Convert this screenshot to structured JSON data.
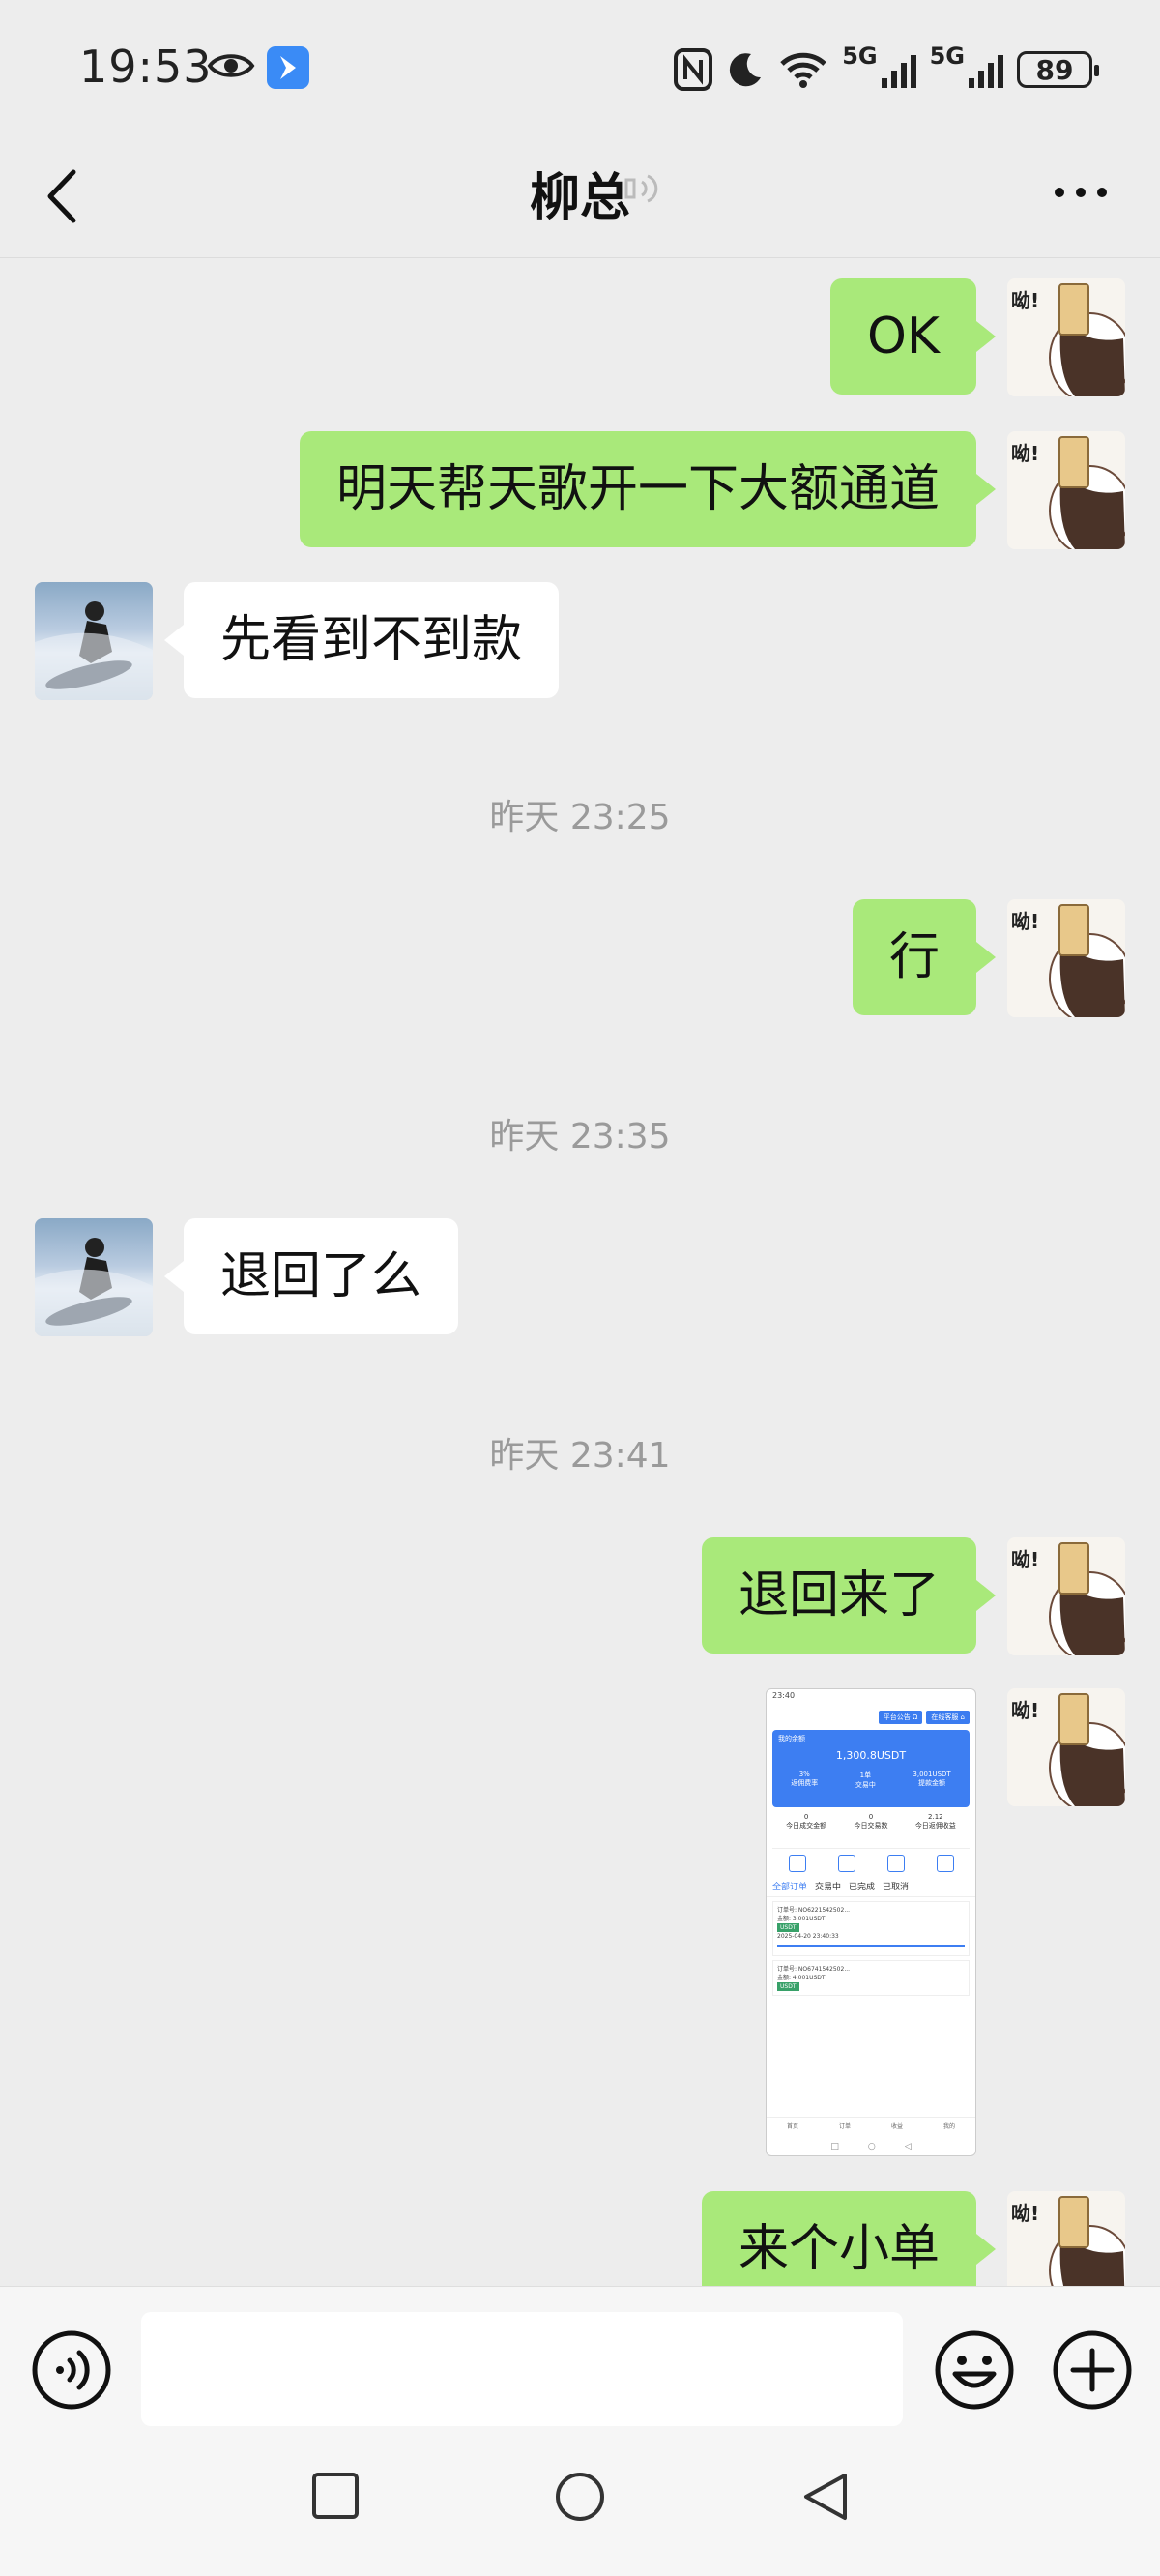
{
  "status_bar": {
    "time": "19:53",
    "signal1_label": "5G",
    "signal2_label": "5G",
    "battery": "89",
    "icons": [
      "eye-icon",
      "app-badge-icon",
      "nfc-icon",
      "moon-icon",
      "wifi-icon",
      "signal-icon",
      "battery-icon"
    ]
  },
  "header": {
    "title": "柳总",
    "icons": [
      "back-icon",
      "voice-mode-icon",
      "more-icon"
    ]
  },
  "messages": [
    {
      "sender": "me",
      "text": "OK"
    },
    {
      "sender": "me",
      "text": "明天帮天歌开一下大额通道"
    },
    {
      "sender": "other",
      "text": "先看到不到款"
    },
    {
      "type": "time",
      "text": "昨天 23:25"
    },
    {
      "sender": "me",
      "text": "行"
    },
    {
      "type": "time",
      "text": "昨天 23:35"
    },
    {
      "sender": "other",
      "text": "退回了么"
    },
    {
      "type": "time",
      "text": "昨天 23:41"
    },
    {
      "sender": "me",
      "text": "退回来了"
    },
    {
      "sender": "me",
      "type": "image"
    },
    {
      "sender": "me",
      "text": "来个小单"
    }
  ],
  "screenshot_preview": {
    "time": "23:40",
    "btn1": "平台公告 Ω",
    "btn2": "在线客服 ⌂",
    "card_title": "我的余额",
    "balance": "1,300.8USDT",
    "card_row": [
      {
        "value": "3%",
        "label": "返佣费率"
      },
      {
        "value": "1单",
        "label": "交易中"
      },
      {
        "value": "3,001USDT",
        "label": "提款金额"
      }
    ],
    "stats": [
      {
        "value": "0",
        "label": "今日成交金额"
      },
      {
        "value": "0",
        "label": "今日交易数"
      },
      {
        "value": "2.12",
        "label": "今日返佣收益"
      }
    ],
    "tabs": [
      "全部订单",
      "交易中",
      "已完成",
      "已取消"
    ],
    "order1_id": "订单号: NO6221542502...",
    "order1_amount": "金额: 3,001USDT",
    "order1_tag": "USDT",
    "order1_time": "2025-04-20 23:40:33",
    "order2_id": "订单号: NO6741542502...",
    "order2_amount": "金额: 4,001USDT",
    "order2_tag": "USDT",
    "bottom_nav": [
      "首页",
      "订单",
      "收益",
      "我的"
    ]
  },
  "input_bar": {
    "placeholder": "",
    "icons": [
      "voice-button-icon",
      "emoji-icon",
      "plus-icon"
    ]
  },
  "system_nav": [
    "square-icon",
    "circle-icon",
    "triangle-back-icon"
  ]
}
